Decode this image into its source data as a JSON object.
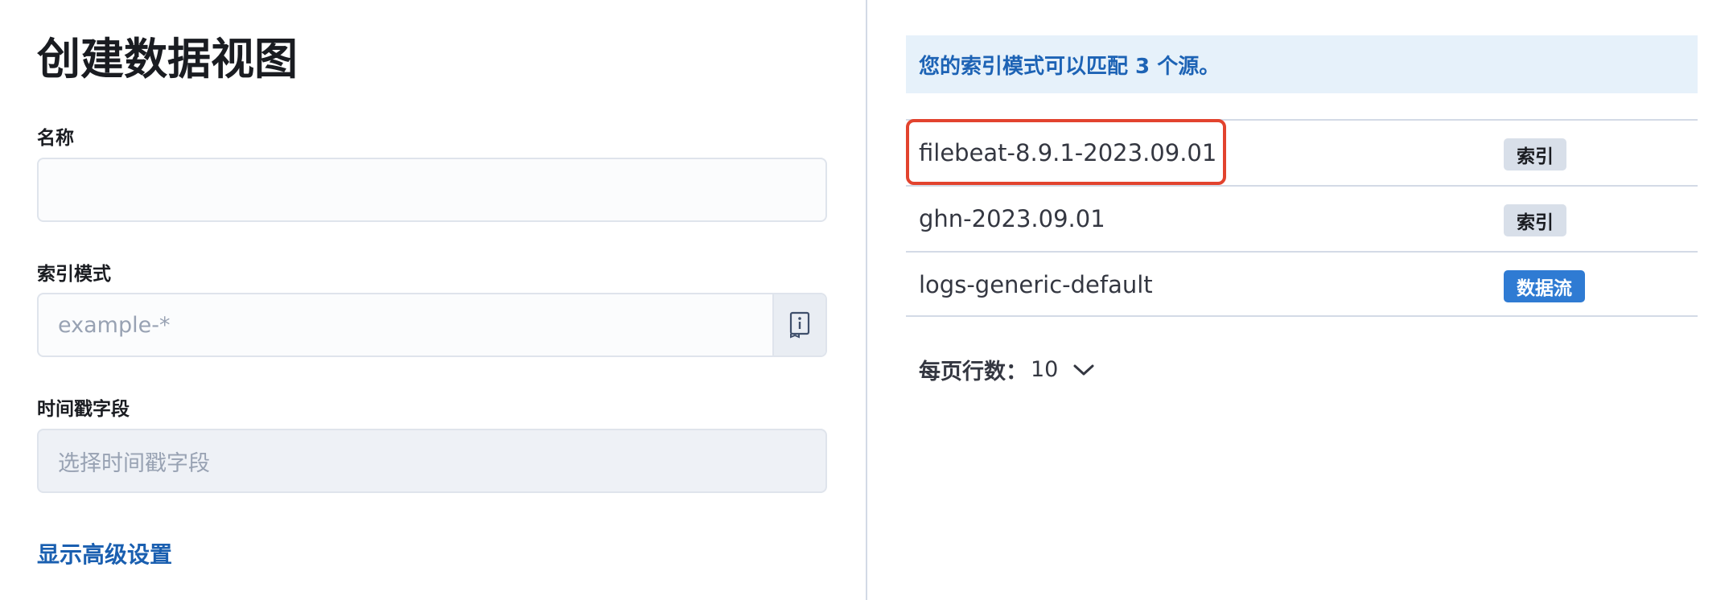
{
  "form": {
    "title": "创建数据视图",
    "name_label": "名称",
    "name_value": "",
    "name_placeholder": "",
    "index_pattern_label": "索引模式",
    "index_pattern_value": "",
    "index_pattern_placeholder": "example-*",
    "timestamp_label": "时间戳字段",
    "timestamp_placeholder": "选择时间戳字段",
    "advanced_link": "显示高级设置",
    "append_icon": "book-info-icon"
  },
  "results": {
    "callout": "您的索引模式可以匹配 3 个源。",
    "rows": [
      {
        "name": "filebeat-8.9.1-2023.09.01",
        "type": "索引",
        "highlighted": true
      },
      {
        "name": "ghn-2023.09.01",
        "type": "索引"
      },
      {
        "name": "logs-generic-default",
        "type": "数据流"
      }
    ],
    "pagination": {
      "label": "每页行数：",
      "value": "10",
      "icon": "chevron-down-icon"
    }
  },
  "colors": {
    "accent": "#1d63b5",
    "callout_bg": "#e6f1fa",
    "highlight": "#e2432e",
    "badge_stream": "#2f7bd3",
    "badge_index": "#d8dfe9"
  }
}
